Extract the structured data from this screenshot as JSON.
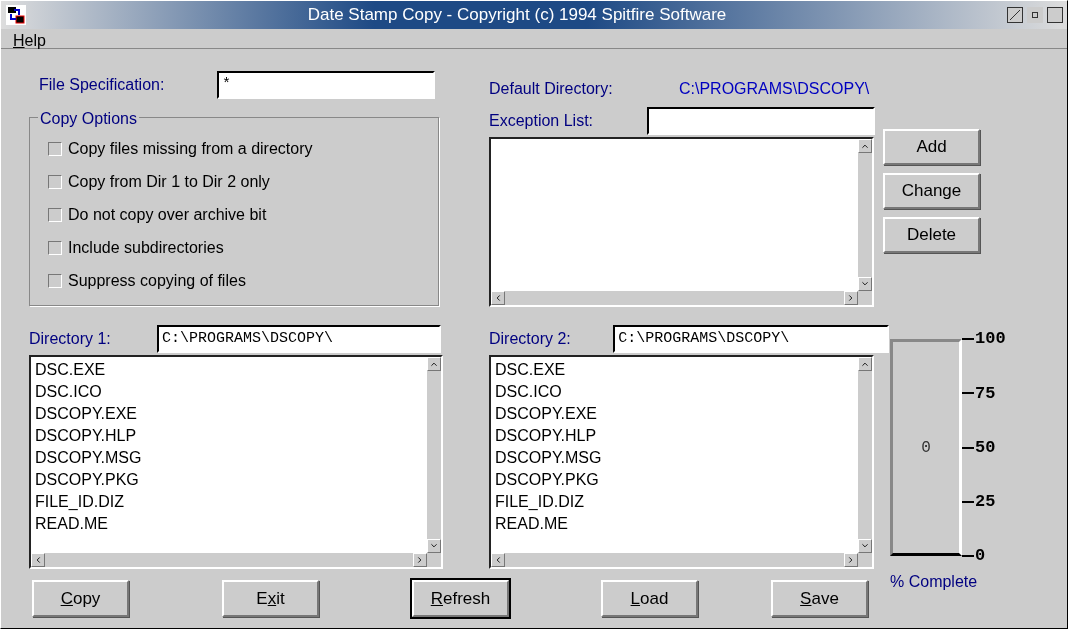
{
  "window": {
    "title": "Date Stamp Copy - Copyright (c) 1994 Spitfire Software"
  },
  "menu": [
    {
      "access_key": "H",
      "label_after": "elp"
    }
  ],
  "file_specification": {
    "label": "File Specification:",
    "value": "*"
  },
  "copy_options": {
    "title": "Copy Options",
    "items": [
      {
        "label": "Copy files missing from a directory",
        "checked": false
      },
      {
        "label": "Copy from Dir 1 to Dir 2 only",
        "checked": false
      },
      {
        "label": "Do not copy over archive bit",
        "checked": false
      },
      {
        "label": "Include subdirectories",
        "checked": false
      },
      {
        "label": "Suppress copying of files",
        "checked": false
      }
    ]
  },
  "default_directory": {
    "label": "Default Directory:",
    "value": "C:\\PROGRAMS\\DSCOPY\\"
  },
  "exception_list": {
    "label": "Exception List:",
    "buttons": [
      "Add",
      "Change",
      "Delete"
    ]
  },
  "directory_1": {
    "label": "Directory 1:",
    "value": "C:\\PROGRAMS\\DSCOPY\\",
    "files": [
      "DSC.EXE",
      "DSC.ICO",
      "DSCOPY.EXE",
      "DSCOPY.HLP",
      "DSCOPY.MSG",
      "DSCOPY.PKG",
      "FILE_ID.DIZ",
      "READ.ME"
    ]
  },
  "directory_2": {
    "label": "Directory 2:",
    "value": "C:\\PROGRAMS\\DSCOPY\\",
    "files": [
      "DSC.EXE",
      "DSC.ICO",
      "DSCOPY.EXE",
      "DSCOPY.HLP",
      "DSCOPY.MSG",
      "DSCOPY.PKG",
      "FILE_ID.DIZ",
      "READ.ME"
    ]
  },
  "progress": {
    "level": 0,
    "reading": "0",
    "ticks": [
      "100",
      "75",
      "50",
      "25",
      "0"
    ],
    "caption": "% Complete"
  },
  "buttons": [
    {
      "access_key": "C",
      "label_after": "opy",
      "default": false
    },
    {
      "label_before": "E",
      "access_key": "x",
      "label_after": "it",
      "default": false
    },
    {
      "access_key": "R",
      "label_after": "efresh",
      "default": true
    },
    {
      "access_key": "L",
      "label_after": "oad",
      "default": false
    },
    {
      "access_key": "S",
      "label_after": "ave",
      "default": false
    }
  ]
}
